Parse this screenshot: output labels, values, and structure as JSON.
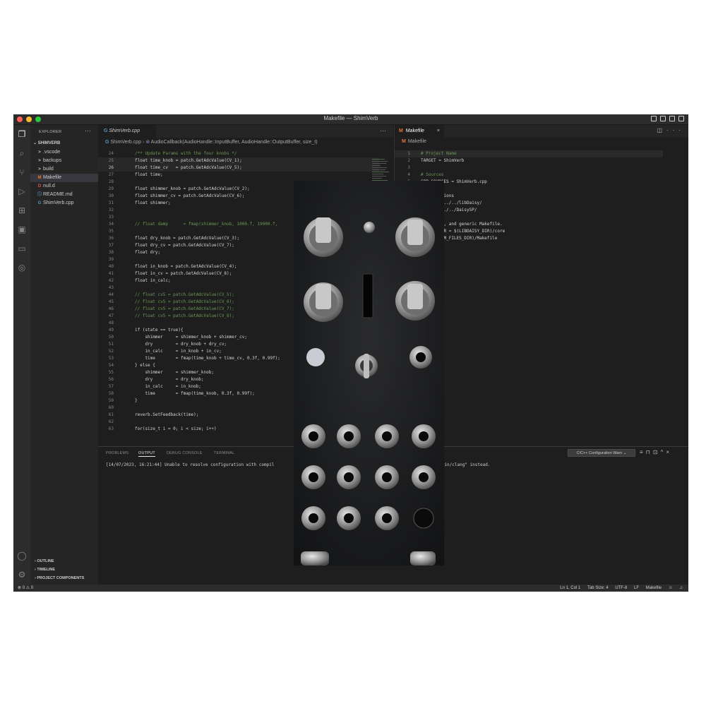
{
  "window": {
    "title": "Makefile — ShimVerb"
  },
  "colors": {
    "close": "#ff5f57",
    "minimize": "#febc2e",
    "zoom": "#28c840",
    "accent": "#0e639c",
    "makefile_icon": "#e37933"
  },
  "activity_bar": [
    "files-icon",
    "search-icon",
    "source-control-icon",
    "run-debug-icon",
    "extensions-icon",
    "remote-explorer-icon",
    "test-icon",
    "serial-monitor-icon",
    "fingerprint-icon",
    "account-icon",
    "settings-icon"
  ],
  "sidebar": {
    "header": "EXPLORER",
    "more": "···",
    "project": "SHIMVERB",
    "items": [
      {
        "icon": ">",
        "label": ".vscode"
      },
      {
        "icon": ">",
        "label": "backups"
      },
      {
        "icon": ">",
        "label": "build"
      },
      {
        "icon": "M",
        "label": "Makefile"
      },
      {
        "icon": "D",
        "label": "null.d"
      },
      {
        "icon": "ⓘ",
        "label": "README.md"
      },
      {
        "icon": "G",
        "label": "ShimVerb.cpp"
      }
    ],
    "bottom": [
      "OUTLINE",
      "TIMELINE",
      "PROJECT COMPONENTS"
    ],
    "settings_badge": "1"
  },
  "editor_left": {
    "tab": "ShimVerb.cpp",
    "more": "···",
    "breadcrumb": {
      "file": "ShimVerb.cpp",
      "symbol": "AudioCallback(AudioHandle::InputBuffer, AudioHandle::OutputBuffer, size_t)"
    },
    "lines": [
      {
        "n": "24",
        "text": "/** Update Params with the four knobs */"
      },
      {
        "n": "25",
        "text": "float time_knob = patch.GetAdcValue(CV_1);"
      },
      {
        "n": "26",
        "text": "float time_cv   = patch.GetAdcValue(CV_5);"
      },
      {
        "n": "27",
        "text": "float time;"
      },
      {
        "n": "28",
        "text": ""
      },
      {
        "n": "29",
        "text": "float shimmer_knob = patch.GetAdcValue(CV_2);"
      },
      {
        "n": "30",
        "text": "float shimmer_cv = patch.GetAdcValue(CV_6);"
      },
      {
        "n": "31",
        "text": "float shimmer;"
      },
      {
        "n": "32",
        "text": ""
      },
      {
        "n": "33",
        "text": ""
      },
      {
        "n": "34",
        "text": "// float damp      = fmap(shimmer_knob, 1000.f, 19000.f,"
      },
      {
        "n": "35",
        "text": ""
      },
      {
        "n": "36",
        "text": "float dry_knob = patch.GetAdcValue(CV_3);"
      },
      {
        "n": "37",
        "text": "float dry_cv = patch.GetAdcValue(CV_7);"
      },
      {
        "n": "38",
        "text": "float dry;"
      },
      {
        "n": "39",
        "text": ""
      },
      {
        "n": "40",
        "text": "float in_knob = patch.GetAdcValue(CV_4);"
      },
      {
        "n": "41",
        "text": "float in_cv = patch.GetAdcValue(CV_8);"
      },
      {
        "n": "42",
        "text": "float in_calc;"
      },
      {
        "n": "43",
        "text": ""
      },
      {
        "n": "44",
        "text": "// float cv5 = patch.GetAdcValue(CV_5);"
      },
      {
        "n": "45",
        "text": "// float cv5 = patch.GetAdcValue(CV_6);"
      },
      {
        "n": "46",
        "text": "// float cv5 = patch.GetAdcValue(CV_7);"
      },
      {
        "n": "47",
        "text": "// float cv5 = patch.GetAdcValue(CV_8);"
      },
      {
        "n": "48",
        "text": ""
      },
      {
        "n": "49",
        "text": "if (state == true){"
      },
      {
        "n": "50",
        "text": "    shimmer     = shimmer_knob + shimmer_cv;"
      },
      {
        "n": "51",
        "text": "    dry         = dry_knob + dry_cv;"
      },
      {
        "n": "52",
        "text": "    in_calc     = in_knob + in_cv;"
      },
      {
        "n": "53",
        "text": "    time        = fmap(time_knob + time_cv, 0.3f, 0.99f);"
      },
      {
        "n": "54",
        "text": "} else {"
      },
      {
        "n": "55",
        "text": "    shimmer     = shimmer_knob;"
      },
      {
        "n": "56",
        "text": "    dry         = dry_knob;"
      },
      {
        "n": "57",
        "text": "    in_calc     = in_knob;"
      },
      {
        "n": "58",
        "text": "    time        = fmap(time_knob, 0.3f, 0.99f);"
      },
      {
        "n": "59",
        "text": "}"
      },
      {
        "n": "60",
        "text": ""
      },
      {
        "n": "61",
        "text": "reverb.SetFeedback(time);"
      },
      {
        "n": "62",
        "text": ""
      },
      {
        "n": "63",
        "text": "for(size_t i = 0; i < size; i++)"
      }
    ]
  },
  "editor_right": {
    "tab": "Makefile",
    "tab_icon": "M",
    "close": "×",
    "breadcrumb": "Makefile",
    "lines": [
      {
        "n": "1",
        "text": "# Project Name"
      },
      {
        "n": "2",
        "text": "TARGET = ShimVerb"
      },
      {
        "n": "3",
        "text": ""
      },
      {
        "n": "4",
        "text": "# Sources"
      },
      {
        "n": "5",
        "text": "CPP_SOURCES = ShimVerb.cpp"
      },
      {
        "n": "",
        "text": ""
      },
      {
        "n": "",
        "text": "  y Locations"
      },
      {
        "n": "",
        "text": "  _DIR = ../../libDaisy/"
      },
      {
        "n": "",
        "text": "  DIR = ../../DaisySP/"
      },
      {
        "n": "",
        "text": ""
      },
      {
        "n": "",
        "text": "  ocation, and generic Makefile."
      },
      {
        "n": "",
        "text": "  ILES_DIR = $(LIBDAISY_DIR)/core"
      },
      {
        "n": "",
        "text": "  $(SYSTEM_FILES_DIR)/Makefile"
      }
    ]
  },
  "panel": {
    "tabs": [
      "PROBLEMS",
      "OUTPUT",
      "DEBUG CONSOLE",
      "TERMINAL"
    ],
    "active": "OUTPUT",
    "select": "C/C++ Configuration Warn ⌄",
    "output_left": "[14/07/2023, 16:21:44] Unable to resolve configuration with compil",
    "output_right": "sr/bin/clang\" instead."
  },
  "statusbar": {
    "left": "⊗ 0 ⚠ 0",
    "position": "Ln 1, Col 1",
    "tab_size": "Tab Size: 4",
    "encoding": "UTF-8",
    "eol": "LF",
    "language": "Makefile"
  }
}
